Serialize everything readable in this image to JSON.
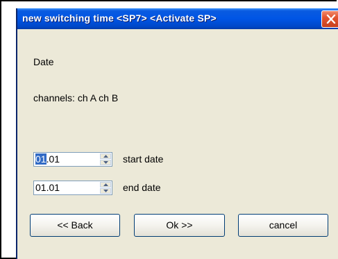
{
  "window": {
    "title": "new switching time <SP7> <Activate SP>"
  },
  "content": {
    "section_label": "Date",
    "channels_text": "channels: ch A ch B"
  },
  "fields": {
    "start": {
      "value_selected": "01",
      "value_rest": ".01",
      "label": "start date"
    },
    "end": {
      "value": "01.01",
      "label": "end date"
    }
  },
  "buttons": {
    "back": "<< Back",
    "ok": "Ok >>",
    "cancel": "cancel"
  },
  "icons": {
    "close": "close-icon",
    "spin_up": "arrow-up-icon",
    "spin_down": "arrow-down-icon"
  },
  "colors": {
    "titlebar": "#0055E5",
    "window_bg": "#ECE9D8",
    "close_button": "#E2542F",
    "selection": "#316AC5"
  }
}
